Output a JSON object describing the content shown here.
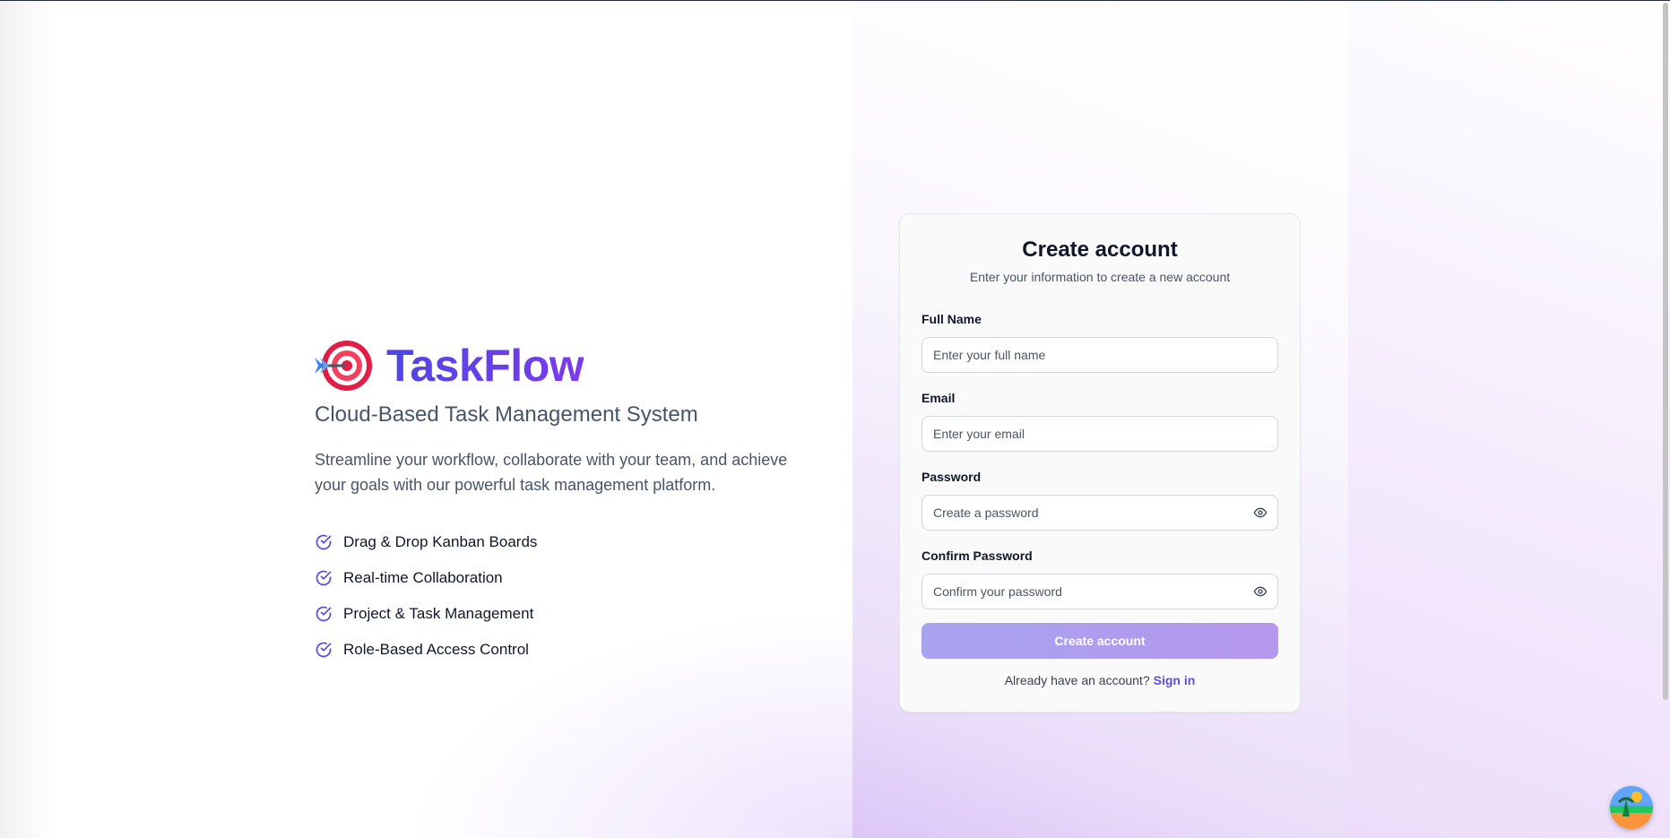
{
  "brand": {
    "name": "TaskFlow",
    "tagline": "Cloud-Based Task Management System",
    "blurb": "Streamline your workflow, collaborate with your team, and achieve your goals with our powerful task management platform.",
    "icon": "target-dart-icon"
  },
  "features": [
    {
      "label": "Drag & Drop Kanban Boards",
      "icon": "check-circle-icon"
    },
    {
      "label": "Real-time Collaboration",
      "icon": "check-circle-icon"
    },
    {
      "label": "Project & Task Management",
      "icon": "check-circle-icon"
    },
    {
      "label": "Role-Based Access Control",
      "icon": "check-circle-icon"
    }
  ],
  "form": {
    "title": "Create account",
    "subtitle": "Enter your information to create a new account",
    "fields": {
      "full_name": {
        "label": "Full Name",
        "placeholder": "Enter your full name",
        "value": ""
      },
      "email": {
        "label": "Email",
        "placeholder": "Enter your email",
        "value": ""
      },
      "password": {
        "label": "Password",
        "placeholder": "Create a password",
        "value": ""
      },
      "confirm_password": {
        "label": "Confirm Password",
        "placeholder": "Confirm your password",
        "value": ""
      }
    },
    "submit_label": "Create account",
    "signin_prompt": "Already have an account?",
    "signin_link": "Sign in"
  },
  "colors": {
    "accent": "#5b4ee0",
    "brand_gradient_start": "#4f46e5",
    "brand_gradient_end": "#7c3aed",
    "button_disabled": "#b3a2ee",
    "check_icon": "#4f46e5"
  }
}
